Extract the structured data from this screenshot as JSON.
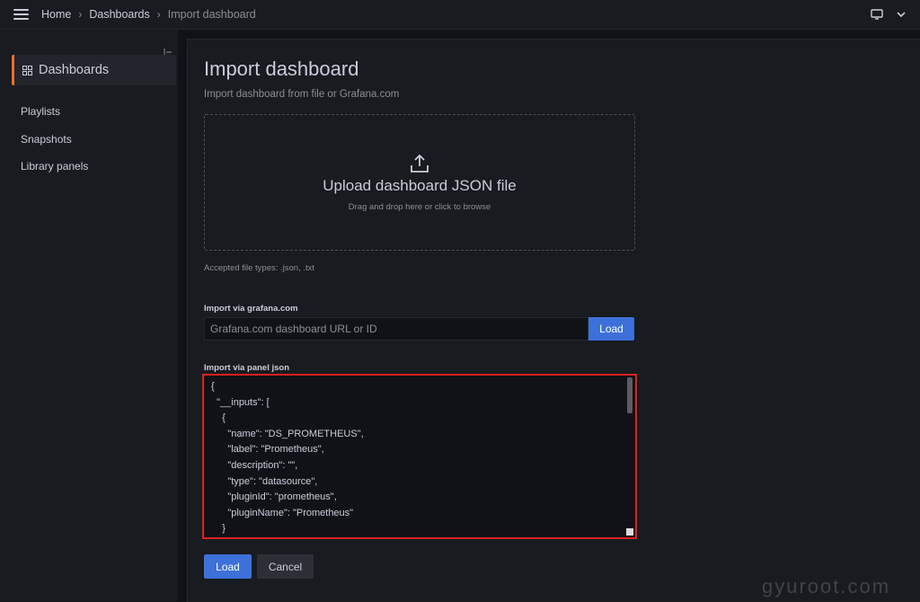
{
  "topbar": {
    "breadcrumbs": [
      "Home",
      "Dashboards",
      "Import dashboard"
    ]
  },
  "sidebar": {
    "title": "Dashboards",
    "items": [
      "Playlists",
      "Snapshots",
      "Library panels"
    ]
  },
  "main": {
    "title": "Import dashboard",
    "subtitle": "Import dashboard from file or Grafana.com",
    "upload": {
      "title": "Upload dashboard JSON file",
      "subtitle": "Drag and drop here or click to browse"
    },
    "accepted_types": "Accepted file types: .json, .txt",
    "grafana_import": {
      "label": "Import via grafana.com",
      "placeholder": "Grafana.com dashboard URL or ID",
      "button": "Load"
    },
    "json_import": {
      "label": "Import via panel json",
      "value": "{\n  \"__inputs\": [\n    {\n      \"name\": \"DS_PROMETHEUS\",\n      \"label\": \"Prometheus\",\n      \"description\": \"\",\n      \"type\": \"datasource\",\n      \"pluginId\": \"prometheus\",\n      \"pluginName\": \"Prometheus\"\n    }"
    },
    "buttons": {
      "load": "Load",
      "cancel": "Cancel"
    }
  },
  "watermark": "gyuroot.com",
  "colors": {
    "accent_sidebar": "#f26d2c",
    "primary_button": "#3d71d9",
    "highlight_box": "#e02020"
  }
}
